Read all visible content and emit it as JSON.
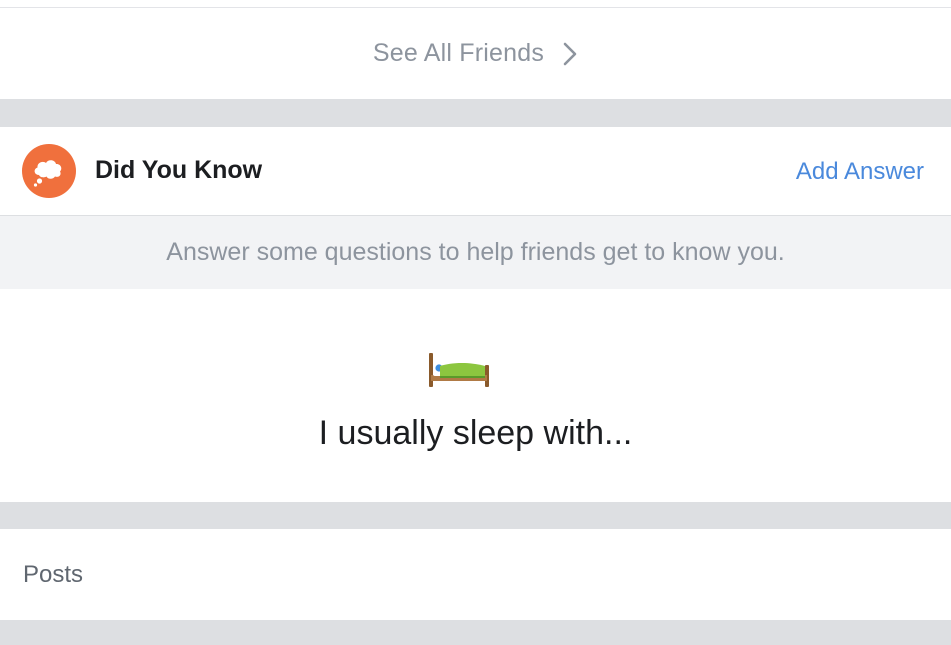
{
  "friends": {
    "see_all_label": "See All Friends",
    "chevron_icon": "chevron-right-icon"
  },
  "did_you_know": {
    "icon": "thought-bubble-icon",
    "title": "Did You Know",
    "action_label": "Add Answer",
    "subtitle": "Answer some questions to help friends get to know you."
  },
  "question": {
    "icon": "bed-emoji-icon",
    "text": "I usually sleep with..."
  },
  "posts": {
    "label": "Posts"
  },
  "colors": {
    "accent": "#4a89dc",
    "icon_orange": "#f0703d",
    "divider_gray": "#dddfe2",
    "muted_text": "#8d949e"
  }
}
